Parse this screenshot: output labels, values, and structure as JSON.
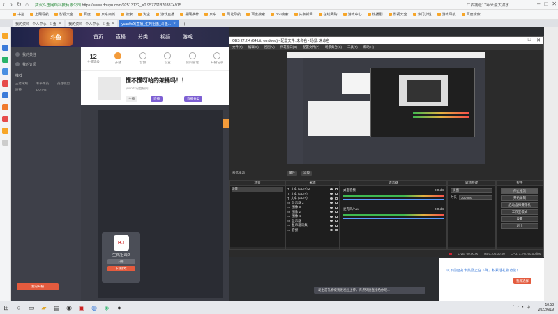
{
  "browser": {
    "url_secure": "武汉斗鱼网络科技有限公司",
    "url": "https://www.douyu.com/9251313?_=0.9577618703874915",
    "search_hint": "广西减退17年来最大洪水",
    "bookmarks": [
      "书签",
      "上网导航",
      "影视大全",
      "百度",
      "京东商城",
      "搜索",
      "淘宝",
      "游戏直播",
      "易网推荐",
      "京东",
      "网址导航",
      "百度搜索",
      "360搜索",
      "头条新闻",
      "在线网购",
      "游戏中心",
      "热播剧",
      "影视大全",
      "热门小说",
      "游戏导航",
      "百度搜索"
    ],
    "tabs": [
      {
        "label": "我的资料 - 个人中心 - 斗鱼",
        "active": false
      },
      {
        "label": "我的资料 - 个人中心 - 斗鱼",
        "active": false
      },
      {
        "label": "yuan0x的直播_生死狙击_斗鱼...",
        "active": true
      }
    ],
    "new_tab": "+"
  },
  "douyu": {
    "logo": "斗鱼",
    "nav": [
      "首页",
      "直播",
      "分类",
      "视频",
      "游戏"
    ],
    "side_top": [
      "我的关注",
      "我的订阅"
    ],
    "side_items": [
      "王者荣耀",
      "和平精英",
      "英雄联盟",
      "原神",
      "DOTA2"
    ],
    "side_section": "推荐",
    "btm_button": "我的开播",
    "stats": [
      {
        "value": "12",
        "label": "主播等级"
      },
      {
        "value": "",
        "label": "开播"
      },
      {
        "value": "",
        "label": "音频"
      },
      {
        "value": "",
        "label": "设置"
      },
      {
        "value": "",
        "label": "房间管理"
      },
      {
        "value": "",
        "label": "开播记录"
      }
    ],
    "room_title": "懂不懂呀哈的架桶吗！！",
    "room_sub": "yuan0x的直播间",
    "tags": [
      "主播",
      "直播",
      "直播分类"
    ],
    "card": {
      "name": "生死狙击2",
      "btn1": "开播",
      "btn2": "下载游戏"
    }
  },
  "obs": {
    "title": "OBS 27.2.4 (64-bit, windows) - 配置文件: 未命名 - 场景: 未命名",
    "menu": [
      "文件(F)",
      "编辑(E)",
      "视图(V)",
      "停靠窗口(D)",
      "配置文件(P)",
      "场景集合(S)",
      "工具(T)",
      "帮助(H)"
    ],
    "scene_label": "未选择源",
    "ctrl_buttons": [
      "属性",
      "滤镜"
    ],
    "scenes_title": "场景",
    "scenes": [
      "场景"
    ],
    "sources_title": "来源",
    "sources": [
      "文本 (GDI+) 2",
      "文本 (GDI+)",
      "文本 (GDI+)",
      "显示器 2",
      "图像 3",
      "图像 2",
      "图像 4",
      "显示器",
      "显示器采集",
      "音频"
    ],
    "mixer_title": "混音器",
    "mixer": [
      {
        "name": "桌面音频",
        "db": "0.0 dB"
      },
      {
        "name": "麦克风/Aux",
        "db": "0.0 dB"
      }
    ],
    "transitions_title": "转场特效",
    "transition_type": "淡出",
    "duration_label": "时长",
    "duration": "300 ms",
    "controls_title": "控件",
    "controls": [
      "停止推流",
      "开始录制",
      "启动虚拟摄像机",
      "工作室模式",
      "设置",
      "退出"
    ],
    "status": {
      "live": "LIVE: 00:00:00",
      "rec": "REC: 00:00:00",
      "cpu": "CPU: 1.2%, 60.00 fps"
    }
  },
  "right_panel": {
    "text": "以下前面打卡奖励正在下降，积累活礼物功能！",
    "button": "我要选择"
  },
  "notice": "发出前礼物被我发发起上传，有点奖励直接给你吧...",
  "taskbar": {
    "time": "10:58",
    "date": "2022/6/19"
  }
}
